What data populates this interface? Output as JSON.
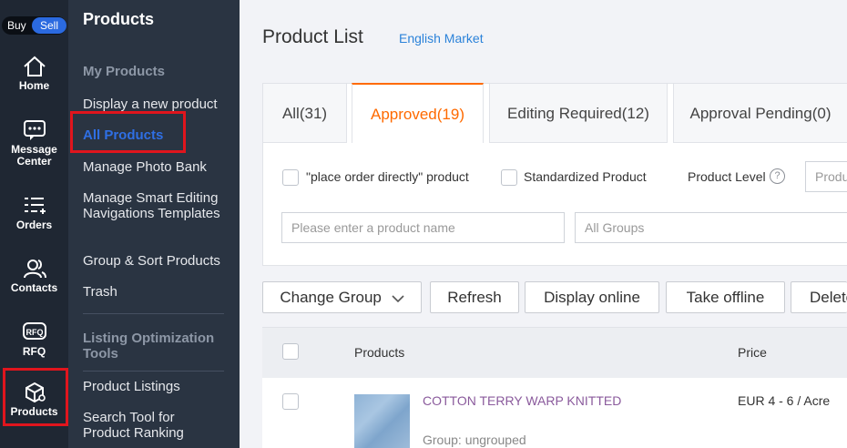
{
  "rail": {
    "buy": "Buy",
    "sell": "Sell",
    "items": [
      {
        "label_1": "Home",
        "label_2": "",
        "icon": "home-icon"
      },
      {
        "label_1": "Message",
        "label_2": "Center",
        "icon": "message-icon"
      },
      {
        "label_1": "Orders",
        "label_2": "",
        "icon": "orders-icon"
      },
      {
        "label_1": "Contacts",
        "label_2": "",
        "icon": "contacts-icon"
      },
      {
        "label_1": "RFQ",
        "label_2": "",
        "icon": "rfq-icon",
        "icon_text": "RFQ"
      },
      {
        "label_1": "Products",
        "label_2": "",
        "icon": "products-icon"
      }
    ]
  },
  "submenu": {
    "title": "Products",
    "section_my_products": "My Products",
    "items": [
      "Display a new product",
      "All Products",
      "Manage Photo Bank",
      "Manage Smart Editing Navigations Templates",
      "Group & Sort Products",
      "Trash"
    ],
    "section_listing": "Listing Optimization Tools",
    "listing_items": [
      "Product Listings",
      "Search Tool for Product Ranking"
    ]
  },
  "main": {
    "title": "Product List",
    "market": "English Market",
    "tabs": [
      "All(31)",
      "Approved(19)",
      "Editing Required(12)",
      "Approval Pending(0)"
    ],
    "filters": {
      "place_order": "\"place order directly\" product",
      "standardized": "Standardized Product",
      "product_level": "Product Level",
      "help_glyph": "?",
      "level_placeholder": "Produ",
      "name_placeholder": "Please enter a product name",
      "groups_placeholder": "All Groups"
    },
    "actions": {
      "change_group": "Change Group",
      "refresh": "Refresh",
      "display_online": "Display online",
      "take_offline": "Take offline",
      "delete": "Delete"
    },
    "table": {
      "col_products": "Products",
      "col_price": "Price",
      "rows": [
        {
          "name": "COTTON TERRY WARP KNITTED",
          "group": "Group: ungrouped",
          "price": "EUR 4 - 6 / Acre"
        }
      ]
    }
  },
  "colors": {
    "accent_orange": "#ff6a00",
    "link_blue": "#2b82d9",
    "highlight_red": "#e0151d"
  }
}
